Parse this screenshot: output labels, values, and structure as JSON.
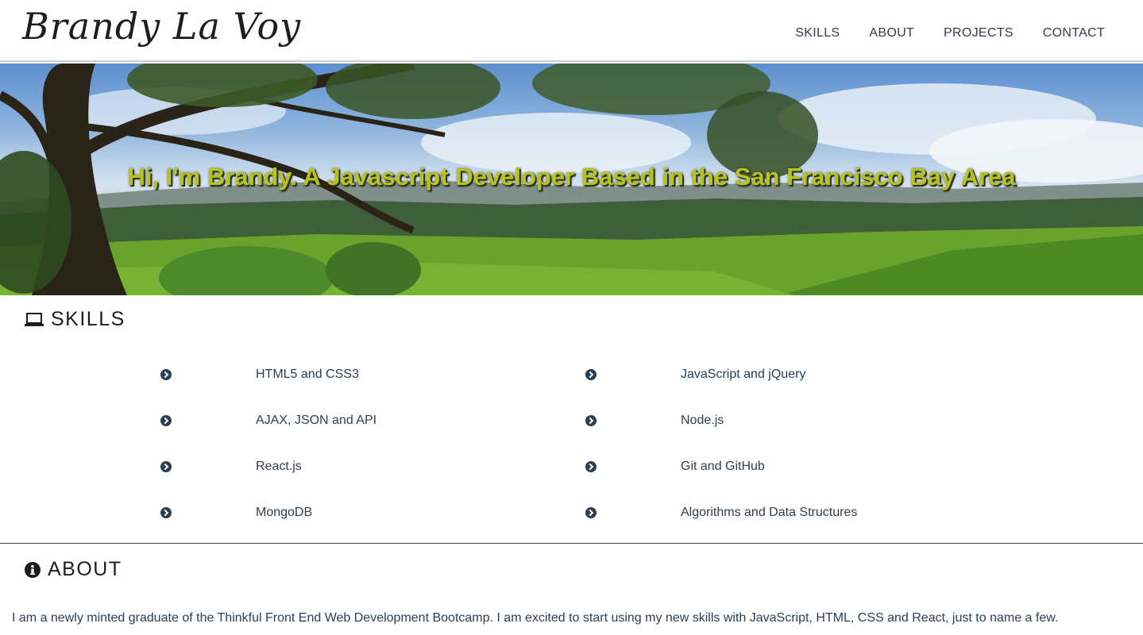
{
  "header": {
    "logo": "Brandy La Voy",
    "nav": [
      "SKILLS",
      "ABOUT",
      "PROJECTS",
      "CONTACT"
    ]
  },
  "hero": {
    "title": "Hi, I'm Brandy. A Javascript Developer Based in the San Francisco Bay Area"
  },
  "skills": {
    "heading": "SKILLS",
    "icon": "laptop-icon",
    "items": [
      "HTML5 and CSS3",
      "JavaScript and jQuery",
      "AJAX, JSON and API",
      "Node.js",
      "React.js",
      "Git and GitHub",
      "MongoDB",
      "Algorithms and Data Structures"
    ]
  },
  "about": {
    "heading": "ABOUT",
    "icon": "info-circle-icon",
    "text": "I am a newly minted graduate of the Thinkful Front End Web Development Bootcamp. I am excited to start using my new skills with JavaScript, HTML, CSS and React, just to name a few."
  },
  "colors": {
    "text": "#2c3e50",
    "hero_title": "#b8c320"
  }
}
